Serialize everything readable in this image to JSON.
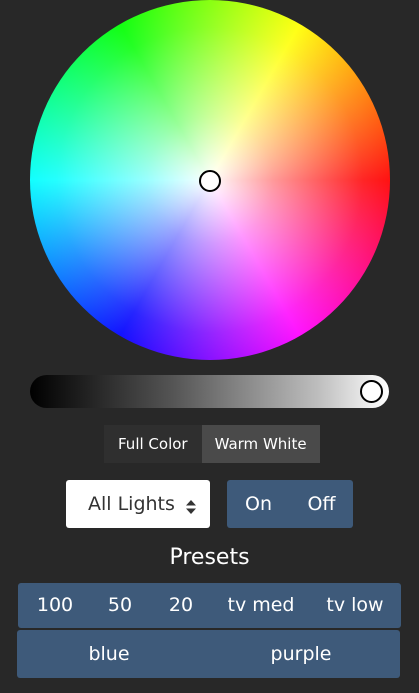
{
  "mode_tabs": {
    "full_color": "Full Color",
    "warm_white": "Warm White",
    "active": "Warm White"
  },
  "brightness": 1.0,
  "light_select": {
    "selected": "All Lights"
  },
  "power": {
    "on": "On",
    "off": "Off"
  },
  "presets": {
    "title": "Presets",
    "row1": [
      "100",
      "50",
      "20",
      "tv med",
      "tv low"
    ],
    "row2": [
      "blue",
      "purple"
    ]
  },
  "colors": {
    "background": "#282828",
    "button_blue": "#3e5a7a",
    "tab_inactive": "#2f2f2f",
    "tab_active": "#4a4a4a"
  }
}
